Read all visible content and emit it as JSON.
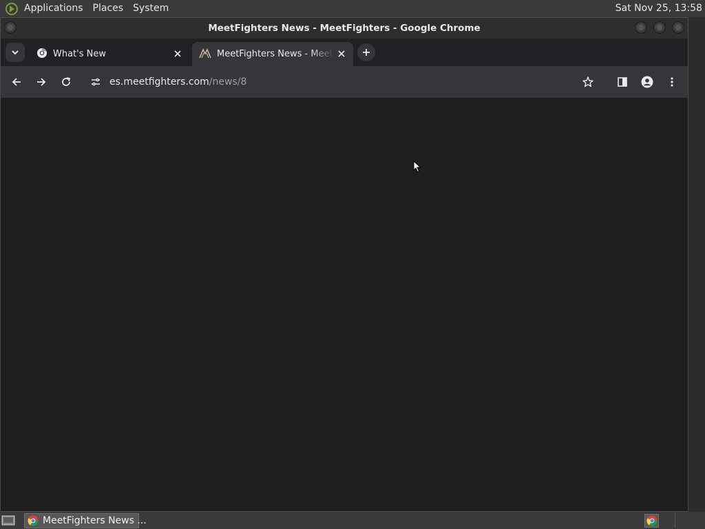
{
  "top_panel": {
    "menus": [
      "Applications",
      "Places",
      "System"
    ],
    "clock": "Sat Nov 25, 13:58"
  },
  "window": {
    "title": "MeetFighters News - MeetFighters - Google Chrome"
  },
  "tabs": [
    {
      "title": "What's New",
      "icon": "chrome-icon",
      "active": false
    },
    {
      "title": "MeetFighters News - MeetFighters",
      "icon": "meetfighters-logo-icon",
      "active": true
    }
  ],
  "omnibox": {
    "domain": "es.meetfighters.com",
    "path": "/news/8"
  },
  "taskbar": {
    "window_button": "MeetFighters News ..."
  },
  "colors": {
    "page_background": "#1f1f1f",
    "toolbar": "#35363a",
    "tabstrip": "#202124",
    "panel": "#3a3a3a"
  }
}
